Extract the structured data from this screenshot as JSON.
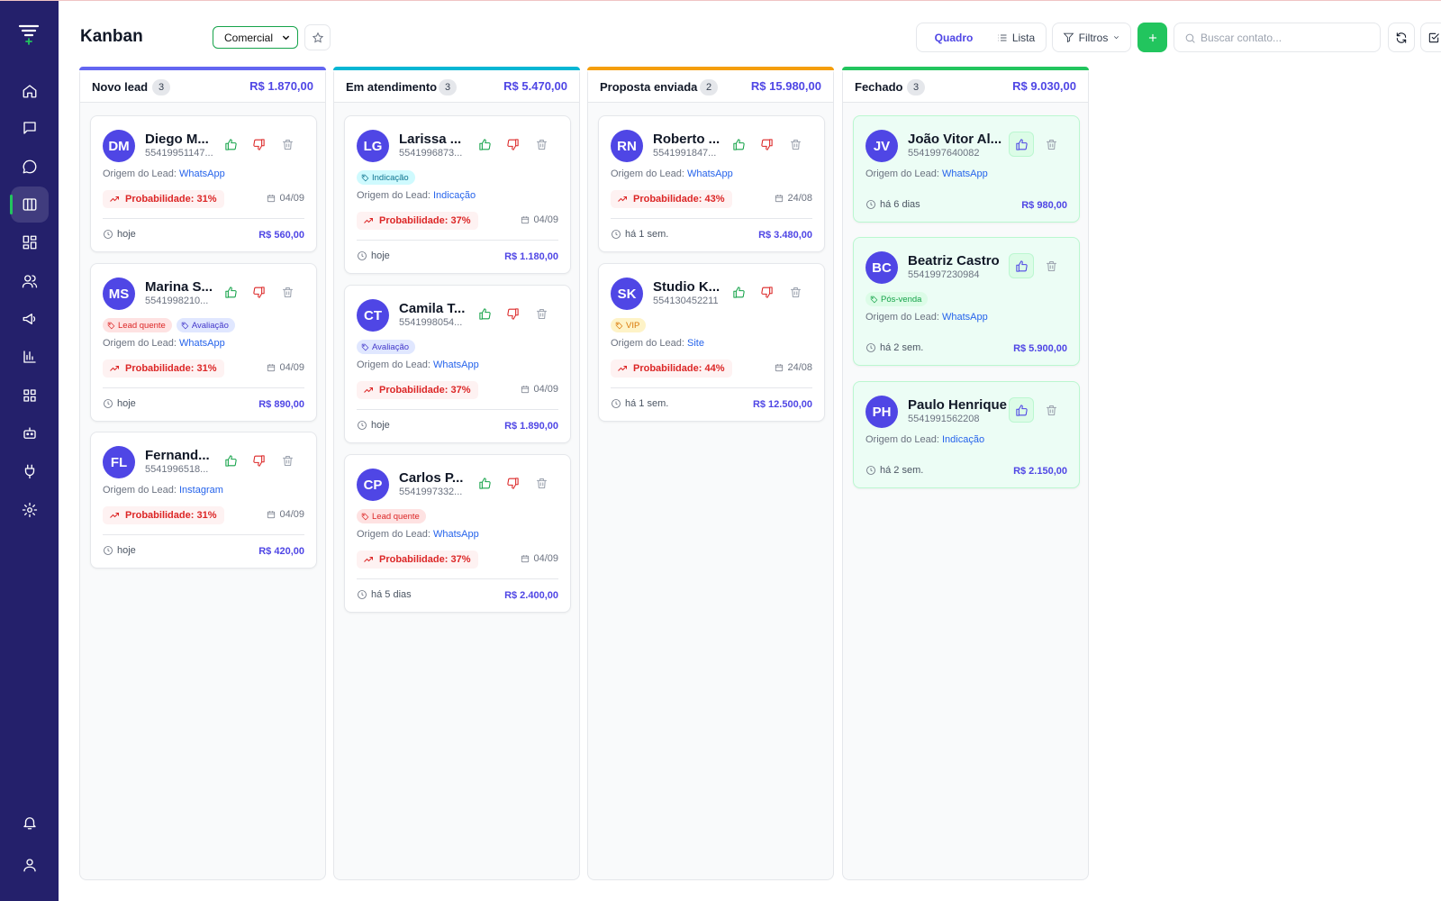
{
  "header": {
    "title": "Kanban",
    "pipeline": "Comercial",
    "view_board": "Quadro",
    "view_list": "Lista",
    "filters": "Filtros",
    "search_placeholder": "Buscar contato..."
  },
  "colors": {
    "sidebar": "#24206b",
    "accent": "#4f46e5",
    "success": "#22c55e",
    "danger": "#dc2626"
  },
  "sidebar": {
    "items": [
      {
        "icon": "home-icon"
      },
      {
        "icon": "message-square-icon"
      },
      {
        "icon": "chat-bubble-icon"
      },
      {
        "icon": "kanban-icon",
        "active": true
      },
      {
        "icon": "dashboard-icon"
      },
      {
        "icon": "users-icon"
      },
      {
        "icon": "megaphone-icon"
      },
      {
        "icon": "bar-chart-icon"
      },
      {
        "icon": "apps-grid-icon"
      },
      {
        "icon": "bot-icon"
      },
      {
        "icon": "plug-icon"
      },
      {
        "icon": "settings-icon"
      },
      {
        "icon": "bell-icon"
      },
      {
        "icon": "user-icon"
      }
    ]
  },
  "columns": [
    {
      "name": "Novo lead",
      "count": "3",
      "total": "R$ 1.870,00",
      "color": "#6366f1",
      "cards": [
        {
          "initials": "DM",
          "name": "Diego M...",
          "phone": "55419951147...",
          "tags": [],
          "origin_label": "Origem do Lead:",
          "origin": "WhatsApp",
          "probability": "Probabilidade: 31%",
          "date": "04/09",
          "since": "hoje",
          "value": "R$ 560,00"
        },
        {
          "initials": "MS",
          "name": "Marina S...",
          "phone": "5541998210...",
          "tags": [
            {
              "label": "Lead quente",
              "kind": "hot"
            },
            {
              "label": "Avaliação",
              "kind": "eval"
            }
          ],
          "origin_label": "Origem do Lead:",
          "origin": "WhatsApp",
          "probability": "Probabilidade: 31%",
          "date": "04/09",
          "since": "hoje",
          "value": "R$ 890,00"
        },
        {
          "initials": "FL",
          "name": "Fernand...",
          "phone": "5541996518...",
          "tags": [],
          "origin_label": "Origem do Lead:",
          "origin": "Instagram",
          "probability": "Probabilidade: 31%",
          "date": "04/09",
          "since": "hoje",
          "value": "R$ 420,00"
        }
      ]
    },
    {
      "name": "Em atendimento",
      "count": "3",
      "total": "R$ 5.470,00",
      "color": "#06b6d4",
      "cards": [
        {
          "initials": "LG",
          "name": "Larissa ...",
          "phone": "5541996873...",
          "tags": [
            {
              "label": "Indicação",
              "kind": "ref"
            }
          ],
          "origin_label": "Origem do Lead:",
          "origin": "Indicação",
          "probability": "Probabilidade: 37%",
          "date": "04/09",
          "since": "hoje",
          "value": "R$ 1.180,00"
        },
        {
          "initials": "CT",
          "name": "Camila T...",
          "phone": "5541998054...",
          "tags": [
            {
              "label": "Avaliação",
              "kind": "eval"
            }
          ],
          "origin_label": "Origem do Lead:",
          "origin": "WhatsApp",
          "probability": "Probabilidade: 37%",
          "date": "04/09",
          "since": "hoje",
          "value": "R$ 1.890,00"
        },
        {
          "initials": "CP",
          "name": "Carlos P...",
          "phone": "5541997332...",
          "tags": [
            {
              "label": "Lead quente",
              "kind": "hot"
            }
          ],
          "origin_label": "Origem do Lead:",
          "origin": "WhatsApp",
          "probability": "Probabilidade: 37%",
          "date": "04/09",
          "since": "há 5 dias",
          "value": "R$ 2.400,00"
        }
      ]
    },
    {
      "name": "Proposta enviada",
      "count": "2",
      "total": "R$ 15.980,00",
      "color": "#f59e0b",
      "cards": [
        {
          "initials": "RN",
          "name": "Roberto ...",
          "phone": "5541991847...",
          "tags": [],
          "origin_label": "Origem do Lead:",
          "origin": "WhatsApp",
          "probability": "Probabilidade: 43%",
          "date": "24/08",
          "since": "há 1 sem.",
          "value": "R$ 3.480,00"
        },
        {
          "initials": "SK",
          "name": "Studio K...",
          "phone": "554130452211",
          "tags": [
            {
              "label": "VIP",
              "kind": "vip"
            }
          ],
          "origin_label": "Origem do Lead:",
          "origin": "Site",
          "probability": "Probabilidade: 44%",
          "date": "24/08",
          "since": "há 1 sem.",
          "value": "R$ 12.500,00"
        }
      ]
    },
    {
      "name": "Fechado",
      "count": "3",
      "total": "R$ 9.030,00",
      "color": "#22c55e",
      "cards": [
        {
          "initials": "JV",
          "name": "João Vitor Al...",
          "phone": "5541997640082",
          "tags": [],
          "origin_label": "Origem do Lead:",
          "origin": "WhatsApp",
          "since": "há 6 dias",
          "value": "R$ 980,00"
        },
        {
          "initials": "BC",
          "name": "Beatriz Castro",
          "phone": "5541997230984",
          "tags": [
            {
              "label": "Pós-venda",
              "kind": "pos"
            }
          ],
          "origin_label": "Origem do Lead:",
          "origin": "WhatsApp",
          "since": "há 2 sem.",
          "value": "R$ 5.900,00"
        },
        {
          "initials": "PH",
          "name": "Paulo Henrique",
          "phone": "5541991562208",
          "tags": [],
          "origin_label": "Origem do Lead:",
          "origin": "Indicação",
          "since": "há 2 sem.",
          "value": "R$ 2.150,00"
        }
      ]
    }
  ]
}
